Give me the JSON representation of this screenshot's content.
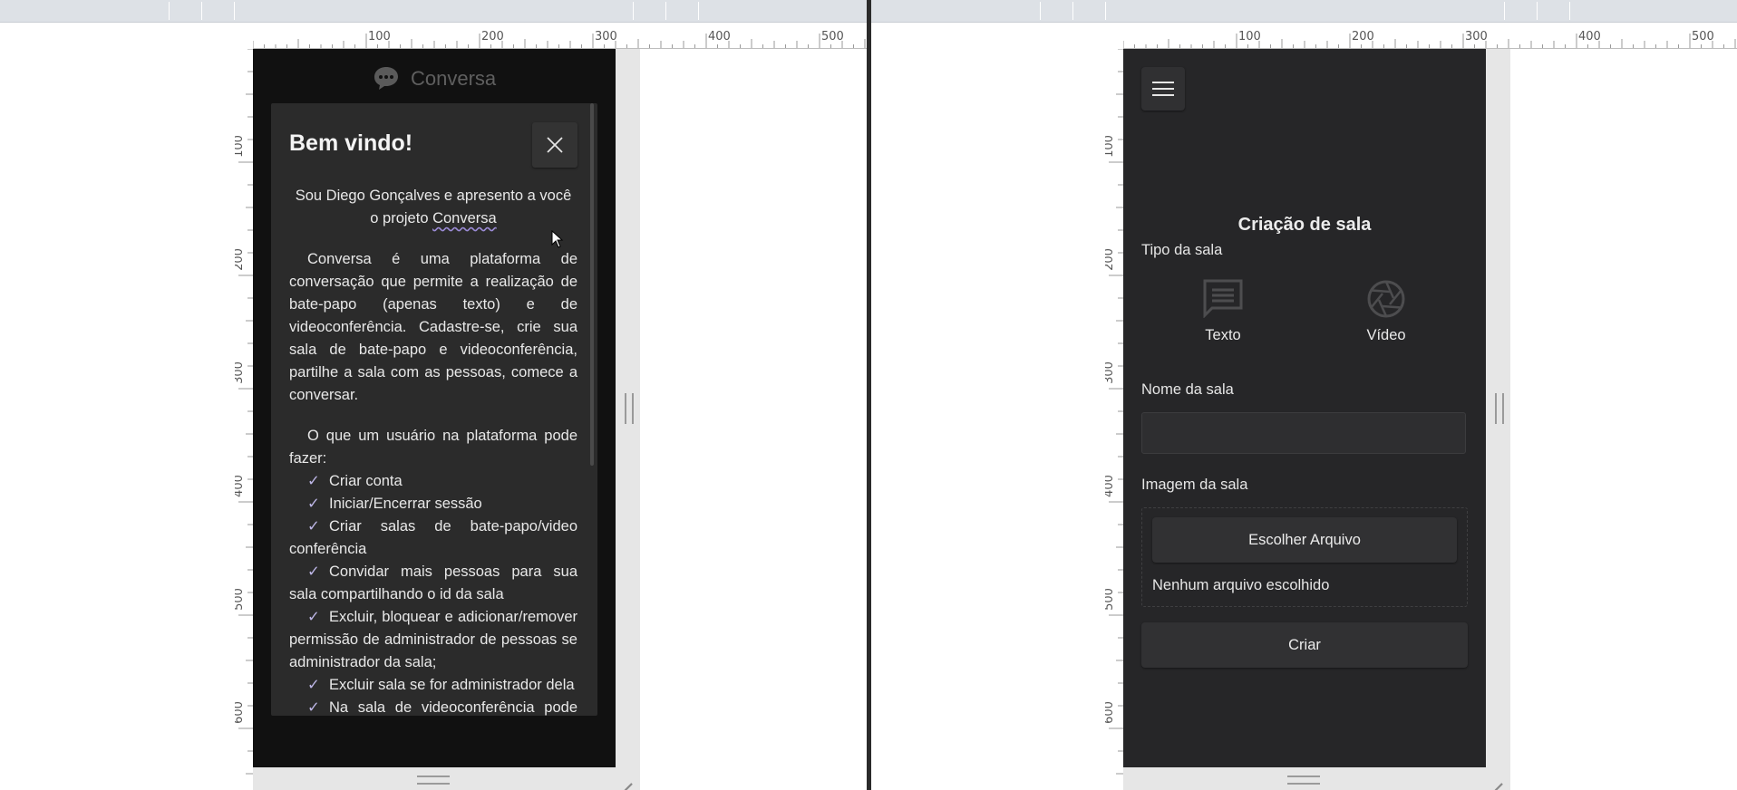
{
  "left": {
    "ruler_labels": [
      "100",
      "200",
      "300",
      "400",
      "500"
    ],
    "ruler_labels_v": [
      "100",
      "200",
      "300",
      "400",
      "500",
      "600"
    ],
    "logo_text": "Conversa",
    "modal": {
      "title": "Bem vindo!",
      "intro_before": "Sou Diego Gonçalves e apresento a você o projeto ",
      "intro_link": "Conversa",
      "paragraph": "Conversa é uma plataforma de conversação que permite a realização de bate-papo (apenas texto) e de videoconferência. Cadastre-se, crie sua sala de bate-papo e videoconferência, partilhe a sala com as pessoas, comece a conversar.",
      "list_intro": "O que um usuário na plataforma pode fazer:",
      "features": [
        "Criar conta",
        "Iniciar/Encerrar sessão",
        "Criar salas de bate-papo/video conferência",
        "Convidar mais pessoas para sua sala compartilhando o id da sala",
        "Excluir, bloquear e adicionar/remover permissão de administrador de pessoas se administrador da sala;",
        "Excluir sala se for administrador dela",
        "Na sala de videoconferência pode encerrar chamada, desabilitar áudio/vídeo"
      ]
    }
  },
  "right": {
    "ruler_labels": [
      "100",
      "200",
      "300",
      "400",
      "500"
    ],
    "ruler_labels_v": [
      "100",
      "200",
      "300",
      "400",
      "500",
      "600"
    ],
    "page_title": "Criação de sala",
    "room_type_label": "Tipo da sala",
    "type_options": [
      "Texto",
      "Vídeo"
    ],
    "room_name_label": "Nome da sala",
    "room_name_value": "",
    "room_image_label": "Imagem da sala",
    "choose_file_label": "Escolher Arquivo",
    "no_file_text": "Nenhum arquivo escolhido",
    "create_label": "Criar"
  },
  "colors": {
    "device_left_bg": "#111111",
    "modal_bg": "#2b2b2b",
    "device_right_bg": "#262628",
    "check_accent": "#bdb6e6"
  },
  "icons": [
    "chat-bubble-logo-icon",
    "close-icon",
    "check-icon",
    "hamburger-menu-icon",
    "chat-text-icon",
    "camera-aperture-icon",
    "mouse-cursor-icon",
    "resize-grip-icon"
  ]
}
